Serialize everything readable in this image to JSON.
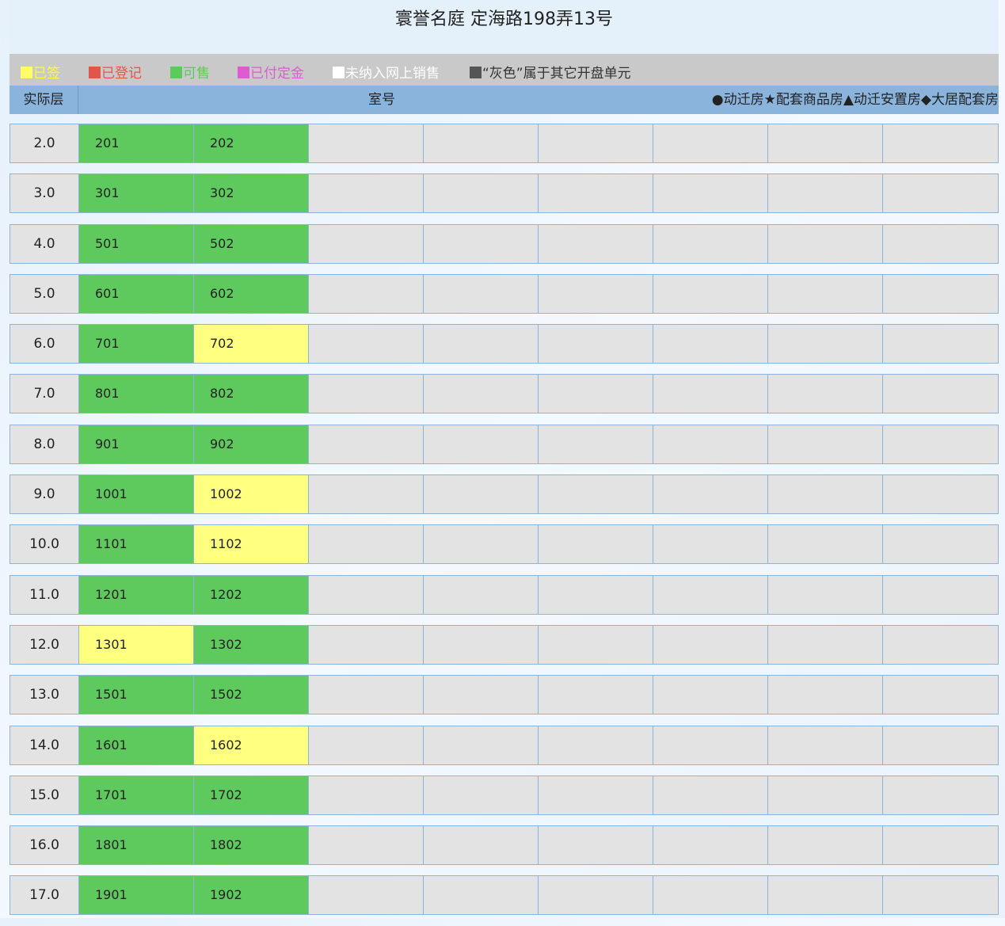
{
  "title": "寰誉名庭 定海路198弄13号",
  "legend": [
    {
      "label": "已签",
      "swatch": "#ffff66",
      "text_color": "#ffff33"
    },
    {
      "label": "已登记",
      "swatch": "#e0574a",
      "text_color": "#e0574a"
    },
    {
      "label": "可售",
      "swatch": "#5ec95c",
      "text_color": "#5ec95c"
    },
    {
      "label": "已付定金",
      "swatch": "#e05ad1",
      "text_color": "#e05ad1"
    },
    {
      "label": "未纳入网上销售",
      "swatch": "#ffffff",
      "text_color": "#ffffff"
    },
    {
      "label": "“灰色”属于其它开盘单元",
      "swatch": "#555555",
      "text_color": "#333333"
    }
  ],
  "header": {
    "floor": "实际层",
    "room": "室号",
    "types": "●动迁房★配套商品房▲动迁安置房◆大居配套房"
  },
  "colors": {
    "available": "#5ec95c",
    "signed": "#ffff80",
    "empty": "#e3e3e3",
    "header_bg": "#8ab4dc"
  },
  "rows": [
    {
      "floor": "2.0",
      "rooms": [
        {
          "no": "201",
          "status": "available"
        },
        {
          "no": "202",
          "status": "available"
        }
      ]
    },
    {
      "floor": "3.0",
      "rooms": [
        {
          "no": "301",
          "status": "available"
        },
        {
          "no": "302",
          "status": "available"
        }
      ]
    },
    {
      "floor": "4.0",
      "rooms": [
        {
          "no": "501",
          "status": "available"
        },
        {
          "no": "502",
          "status": "available"
        }
      ]
    },
    {
      "floor": "5.0",
      "rooms": [
        {
          "no": "601",
          "status": "available"
        },
        {
          "no": "602",
          "status": "available"
        }
      ]
    },
    {
      "floor": "6.0",
      "rooms": [
        {
          "no": "701",
          "status": "available"
        },
        {
          "no": "702",
          "status": "signed"
        }
      ]
    },
    {
      "floor": "7.0",
      "rooms": [
        {
          "no": "801",
          "status": "available"
        },
        {
          "no": "802",
          "status": "available"
        }
      ]
    },
    {
      "floor": "8.0",
      "rooms": [
        {
          "no": "901",
          "status": "available"
        },
        {
          "no": "902",
          "status": "available"
        }
      ]
    },
    {
      "floor": "9.0",
      "rooms": [
        {
          "no": "1001",
          "status": "available"
        },
        {
          "no": "1002",
          "status": "signed"
        }
      ]
    },
    {
      "floor": "10.0",
      "rooms": [
        {
          "no": "1101",
          "status": "available"
        },
        {
          "no": "1102",
          "status": "signed"
        }
      ]
    },
    {
      "floor": "11.0",
      "rooms": [
        {
          "no": "1201",
          "status": "available"
        },
        {
          "no": "1202",
          "status": "available"
        }
      ]
    },
    {
      "floor": "12.0",
      "rooms": [
        {
          "no": "1301",
          "status": "signed"
        },
        {
          "no": "1302",
          "status": "available"
        }
      ]
    },
    {
      "floor": "13.0",
      "rooms": [
        {
          "no": "1501",
          "status": "available"
        },
        {
          "no": "1502",
          "status": "available"
        }
      ]
    },
    {
      "floor": "14.0",
      "rooms": [
        {
          "no": "1601",
          "status": "available"
        },
        {
          "no": "1602",
          "status": "signed"
        }
      ]
    },
    {
      "floor": "15.0",
      "rooms": [
        {
          "no": "1701",
          "status": "available"
        },
        {
          "no": "1702",
          "status": "available"
        }
      ]
    },
    {
      "floor": "16.0",
      "rooms": [
        {
          "no": "1801",
          "status": "available"
        },
        {
          "no": "1802",
          "status": "available"
        }
      ]
    },
    {
      "floor": "17.0",
      "rooms": [
        {
          "no": "1901",
          "status": "available"
        },
        {
          "no": "1902",
          "status": "available"
        }
      ]
    }
  ]
}
